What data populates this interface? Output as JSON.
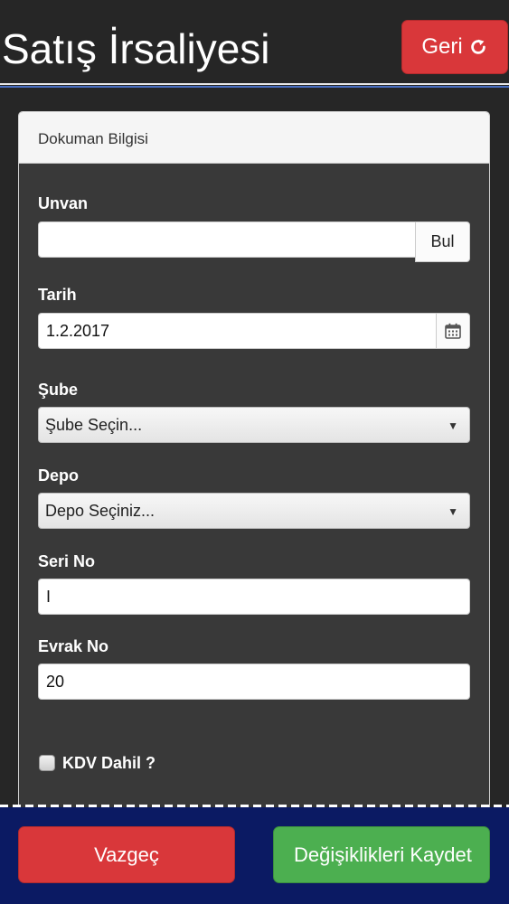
{
  "header": {
    "title": "Satış İrsaliyesi",
    "back_label": "Geri"
  },
  "panel": {
    "heading": "Dokuman Bilgisi"
  },
  "form": {
    "unvan": {
      "label": "Unvan",
      "value": "",
      "button_label": "Bul"
    },
    "tarih": {
      "label": "Tarih",
      "value": "1.2.2017"
    },
    "sube": {
      "label": "Şube",
      "selected": "Şube Seçin..."
    },
    "depo": {
      "label": "Depo",
      "selected": "Depo Seçiniz..."
    },
    "seri_no": {
      "label": "Seri No",
      "value": "I"
    },
    "evrak_no": {
      "label": "Evrak No",
      "value": "20"
    },
    "kdv": {
      "label": "KDV Dahil ?",
      "checked": false
    }
  },
  "footer": {
    "cancel_label": "Vazgeç",
    "save_label": "Değişiklikleri Kaydet"
  },
  "colors": {
    "danger": "#d9373a",
    "success": "#4caf50",
    "footer_bg": "#0b1a63",
    "page_bg": "#262626"
  }
}
